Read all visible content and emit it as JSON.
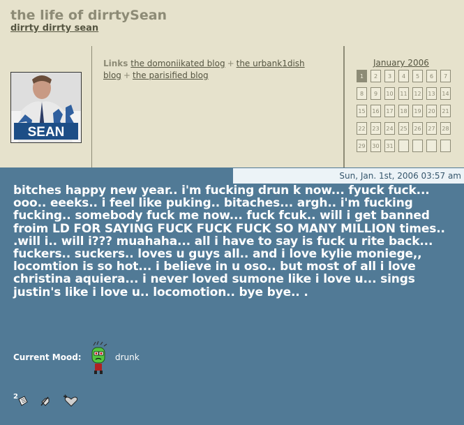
{
  "header": {
    "title": "the life of dirrtySean",
    "subtitle": "dirrty dirrty sean"
  },
  "userpic": {
    "caption": "SEAN"
  },
  "links": {
    "label": "Links",
    "items": [
      "the domoniikated blog",
      "the urbank1dish blog",
      "the parisified blog"
    ]
  },
  "calendar": {
    "title": "January 2006",
    "days": [
      "1",
      "2",
      "3",
      "4",
      "5",
      "6",
      "7",
      "8",
      "9",
      "10",
      "11",
      "12",
      "13",
      "14",
      "15",
      "16",
      "17",
      "18",
      "19",
      "20",
      "21",
      "22",
      "23",
      "24",
      "25",
      "26",
      "27",
      "28",
      "29",
      "30",
      "31"
    ],
    "today": "1"
  },
  "entry": {
    "date": "Sun, Jan. 1st, 2006 03:57 am",
    "body": "bitches happy new year.. i'm fucking drun k now... fyuck fuck... ooo.. eeeks.. i feel like puking.. bitaches... argh.. i'm fucking fucking.. somebody fuck me now... fuck fcuk.. will i get banned froim LD FOR SAYING FUCK FUCK FUCK SO MANY MILLION times.. .will i.. will i??? muahaha... all i have to say is fuck u rite back... fuckers.. suckers.. loves u guys all.. and i love kylie moniege,, locomtion is so hot... i believe in u oso.. but most of all i love christina aquiera... i never loved sumone like i love u... sings justin's like i love u.. locomotion.. bye bye.. .",
    "mood_label": "Current Mood:",
    "mood_value": "drunk",
    "mood_icon": "drunk-face-icon",
    "comments_count": "2"
  }
}
